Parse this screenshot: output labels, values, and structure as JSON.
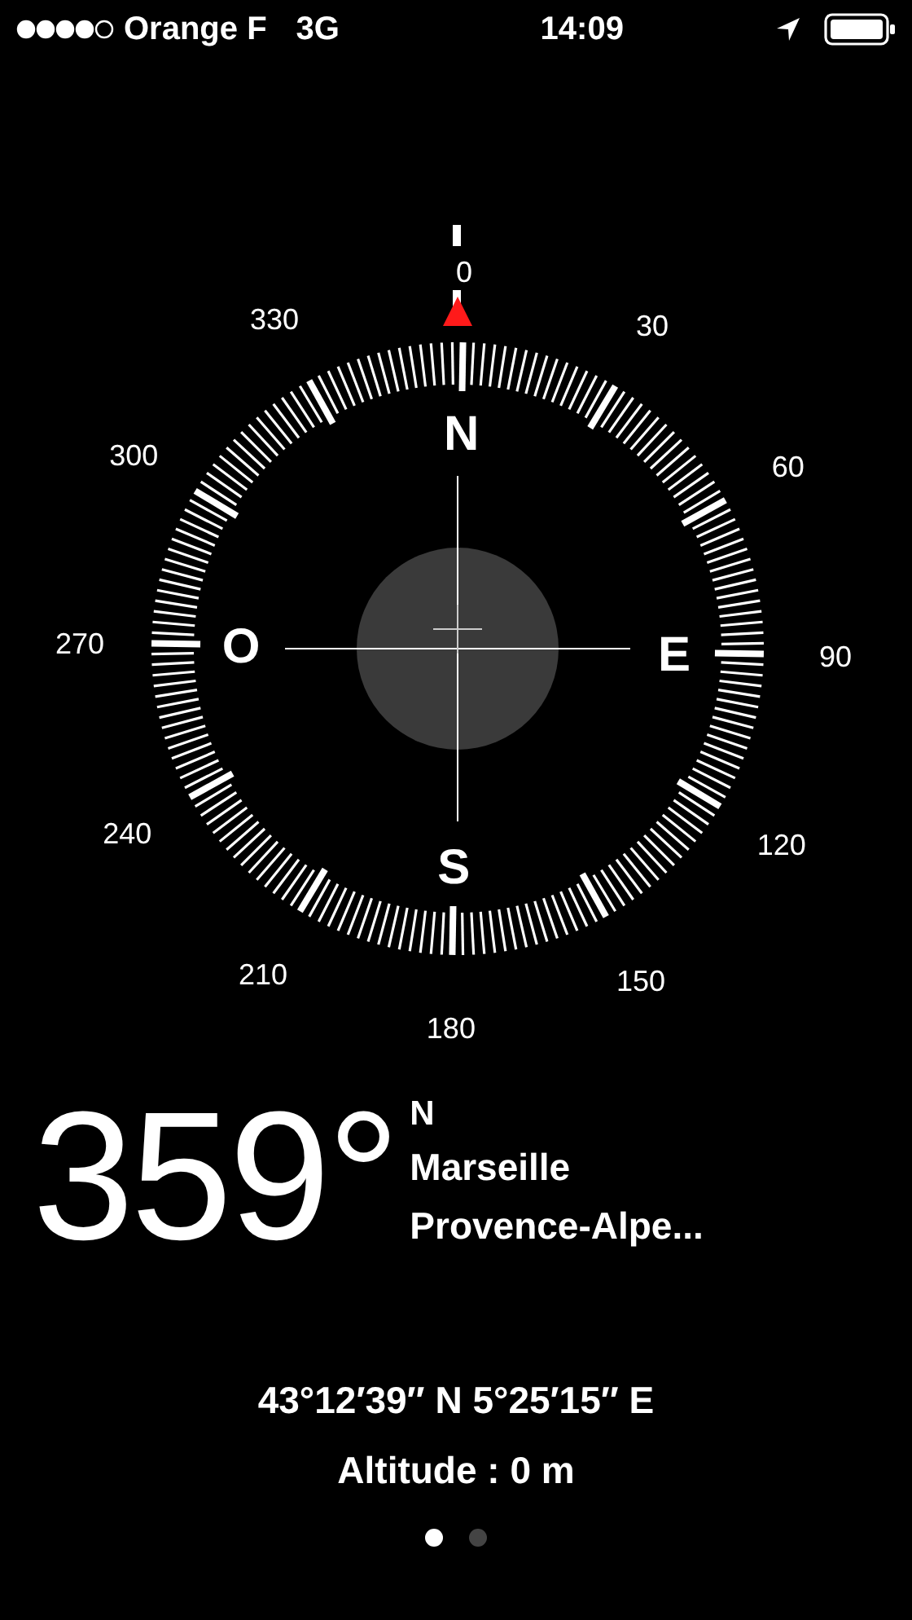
{
  "status_bar": {
    "carrier": "Orange F",
    "network": "3G",
    "time": "14:09"
  },
  "compass": {
    "degree_labels": [
      "0",
      "30",
      "60",
      "90",
      "120",
      "150",
      "180",
      "210",
      "240",
      "270",
      "300",
      "330"
    ],
    "cardinals": [
      "N",
      "E",
      "S",
      "O"
    ]
  },
  "heading": {
    "degrees": "359°",
    "direction": "N",
    "city": "Marseille",
    "region": "Provence-Alpe..."
  },
  "coordinates": "43°12′39″ N  5°25′15″ E",
  "altitude": "Altitude : 0 m",
  "pages": [
    {
      "selected": true
    },
    {
      "selected": false
    }
  ]
}
